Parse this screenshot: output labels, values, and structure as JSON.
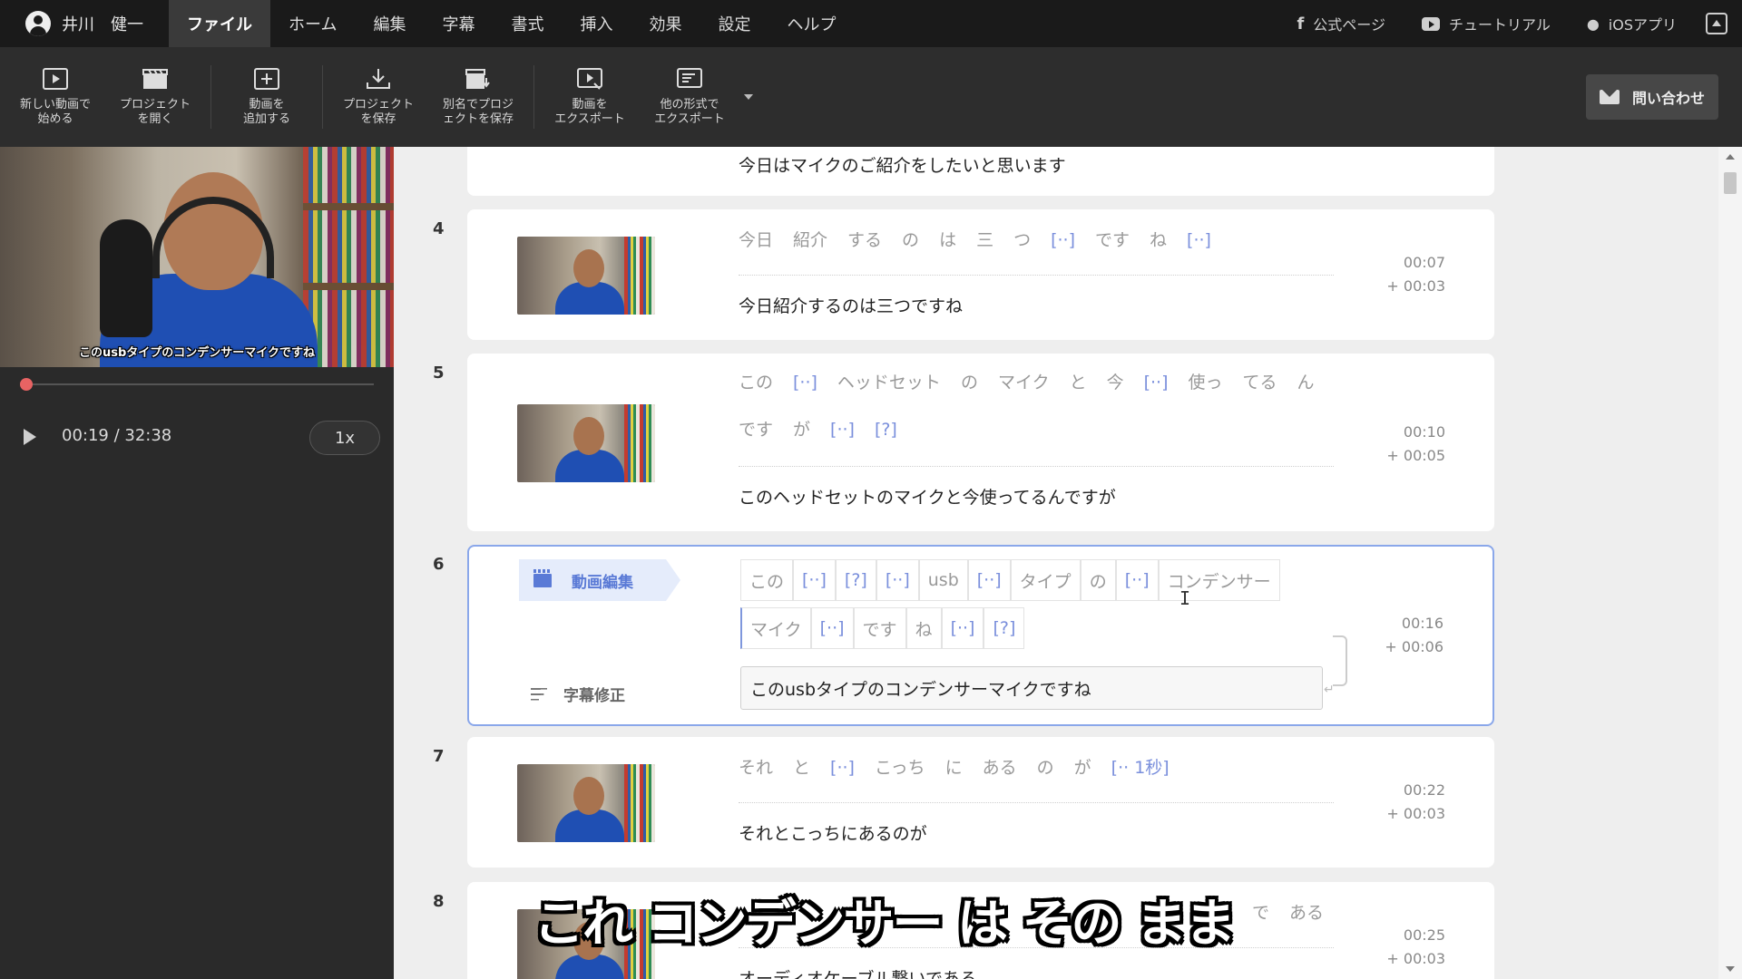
{
  "menubar": {
    "user_name": "井川　健一",
    "items": [
      "ファイル",
      "ホーム",
      "編集",
      "字幕",
      "書式",
      "挿入",
      "効果",
      "設定",
      "ヘルプ"
    ],
    "active_item": "ファイル",
    "links": [
      {
        "label": "公式ページ",
        "icon": "facebook-icon"
      },
      {
        "label": "チュートリアル",
        "icon": "youtube-icon"
      },
      {
        "label": "iOSアプリ",
        "icon": "apple-icon"
      }
    ]
  },
  "toolbar": {
    "new_video": "新しい動画で\n始める",
    "open_project": "プロジェクト\nを開く",
    "add_video": "動画を\n追加する",
    "save_project": "プロジェクト\nを保存",
    "save_as": "別名でプロジ\nェクトを保存",
    "export_video": "動画を\nエクスポート",
    "export_other": "他の形式で\nエクスポート",
    "contact": "問い合わせ"
  },
  "player": {
    "caption": "このusbタイプのコンデンサーマイクですね",
    "time": "00:19 / 32:38",
    "speed": "1x",
    "progress": 0.01
  },
  "rows": {
    "r3": {
      "subtitle": "今日はマイクのご紹介をしたいと思います"
    },
    "r4": {
      "num": "4",
      "words": [
        "今日",
        "紹介",
        "する",
        "の",
        "は",
        "三",
        "つ",
        "[··]",
        "です",
        "ね",
        "[··]"
      ],
      "subtitle": "今日紹介するのは三つですね",
      "start": "00:07",
      "duration": "+ 00:03"
    },
    "r5": {
      "num": "5",
      "words": [
        "この",
        "[··]",
        "ヘッドセット",
        "の",
        "マイク",
        "と",
        "今",
        "[··]",
        "使っ",
        "てる",
        "ん",
        "です",
        "が",
        "[··]",
        "[?]"
      ],
      "subtitle": "このヘッドセットのマイクと今使ってるんですが",
      "start": "00:10",
      "duration": "+ 00:05"
    },
    "r6": {
      "num": "6",
      "edit_tag": "動画編集",
      "subfix_tag": "字幕修正",
      "chips_row1": [
        "この",
        "[··]",
        "[?]",
        "[··]",
        "usb",
        "[··]",
        "タイプ",
        "の",
        "[··]",
        "コンデンサー"
      ],
      "chips_row2": [
        "マイク",
        "[··]",
        "です",
        "ね",
        "[··]",
        "[?]"
      ],
      "subtitle": "このusbタイプのコンデンサーマイクですね",
      "start": "00:16",
      "duration": "+ 00:06"
    },
    "r7": {
      "num": "7",
      "words": [
        "それ",
        "と",
        "[··]",
        "こっち",
        "に",
        "ある",
        "の",
        "が"
      ],
      "pause_label": "[·· 1秒]",
      "subtitle": "それとこっちにあるのが",
      "start": "00:22",
      "duration": "+ 00:03"
    },
    "r8": {
      "num": "8",
      "words_visible": [
        "で",
        "ある"
      ],
      "subtitle": "オーディオケーブル繋いである",
      "start": "00:25",
      "duration": "+ 00:03"
    }
  },
  "overlay_caption": "これ コンデンサー は その まま"
}
